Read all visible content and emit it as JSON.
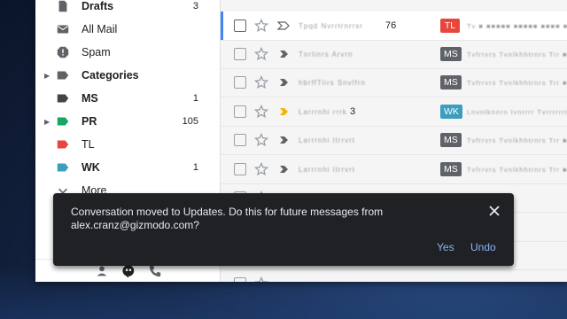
{
  "sidebar": {
    "items": [
      {
        "label": "Drafts",
        "count": "3",
        "bold": true,
        "icon": "drafts-icon"
      },
      {
        "label": "All Mail",
        "count": "",
        "bold": false,
        "icon": "all-mail-icon"
      },
      {
        "label": "Spam",
        "count": "",
        "bold": false,
        "icon": "spam-icon"
      },
      {
        "label": "Categories",
        "count": "",
        "bold": true,
        "icon": "categories-label-icon",
        "arrow": "▶"
      },
      {
        "label": "MS",
        "count": "1",
        "bold": true,
        "icon": "label-icon",
        "color": "#444444"
      },
      {
        "label": "PR",
        "count": "105",
        "bold": true,
        "icon": "label-icon",
        "color": "#16a765",
        "arrow": "▶"
      },
      {
        "label": "TL",
        "count": "",
        "bold": false,
        "icon": "label-icon",
        "color": "#e8453c"
      },
      {
        "label": "WK",
        "count": "1",
        "bold": true,
        "icon": "label-icon",
        "color": "#3c9dbd"
      },
      {
        "label": "More",
        "count": "",
        "bold": false,
        "icon": "chevron-down-icon"
      }
    ],
    "bottom_icons": [
      "person-icon",
      "hangouts-icon",
      "phone-icon"
    ]
  },
  "emails": [
    {
      "sender": "Tpqd Nvrrtrnrrsr",
      "count": "76",
      "tag": "TL",
      "tag_color": "#e8453c",
      "snippet": "Tv  ■ ■■■■■ ■■■■■ ■■■■ ■■■■■"
    },
    {
      "sender": "Tnrlinrs Arvrn",
      "count": "",
      "tag": "MS",
      "tag_color": "#5f6368",
      "snippet": "Tvfrrvrs Tvnlkhhtrnrs Trr ■■■■"
    },
    {
      "sender": "hbrffTiirs Snvlfrn",
      "count": "",
      "tag": "MS",
      "tag_color": "#5f6368",
      "snippet": "Tvfrrvrs Tvnlkhhtrnrs Trr ■■■■"
    },
    {
      "sender": "Larrrnhi  rrrk",
      "count": "3",
      "tag": "WK",
      "tag_color": "#3c9dbd",
      "snippet": "Lnvnlknnrn  lvnrrrr  Tvrrrrrrr ■■"
    },
    {
      "sender": "Larrrnhi  ltrrvrt",
      "count": "",
      "tag": "MS",
      "tag_color": "#5f6368",
      "snippet": "Tvfrrvrs Tvnlkhhtrnrs Trr ■■■■"
    },
    {
      "sender": "Larrrnhi  ltrrvrt",
      "count": "",
      "tag": "MS",
      "tag_color": "#5f6368",
      "snippet": "Tvfrrvrs Tvnlkhhtrnrs Trr ■■■■"
    }
  ],
  "snackbar": {
    "message": "Conversation moved to Updates. Do this for future messages from alex.cranz@gizmodo.com?",
    "yes_label": "Yes",
    "undo_label": "Undo"
  },
  "colors": {
    "accent": "#8ab4f8",
    "toast_bg": "#202124",
    "important_yellow": "#f4b400"
  }
}
